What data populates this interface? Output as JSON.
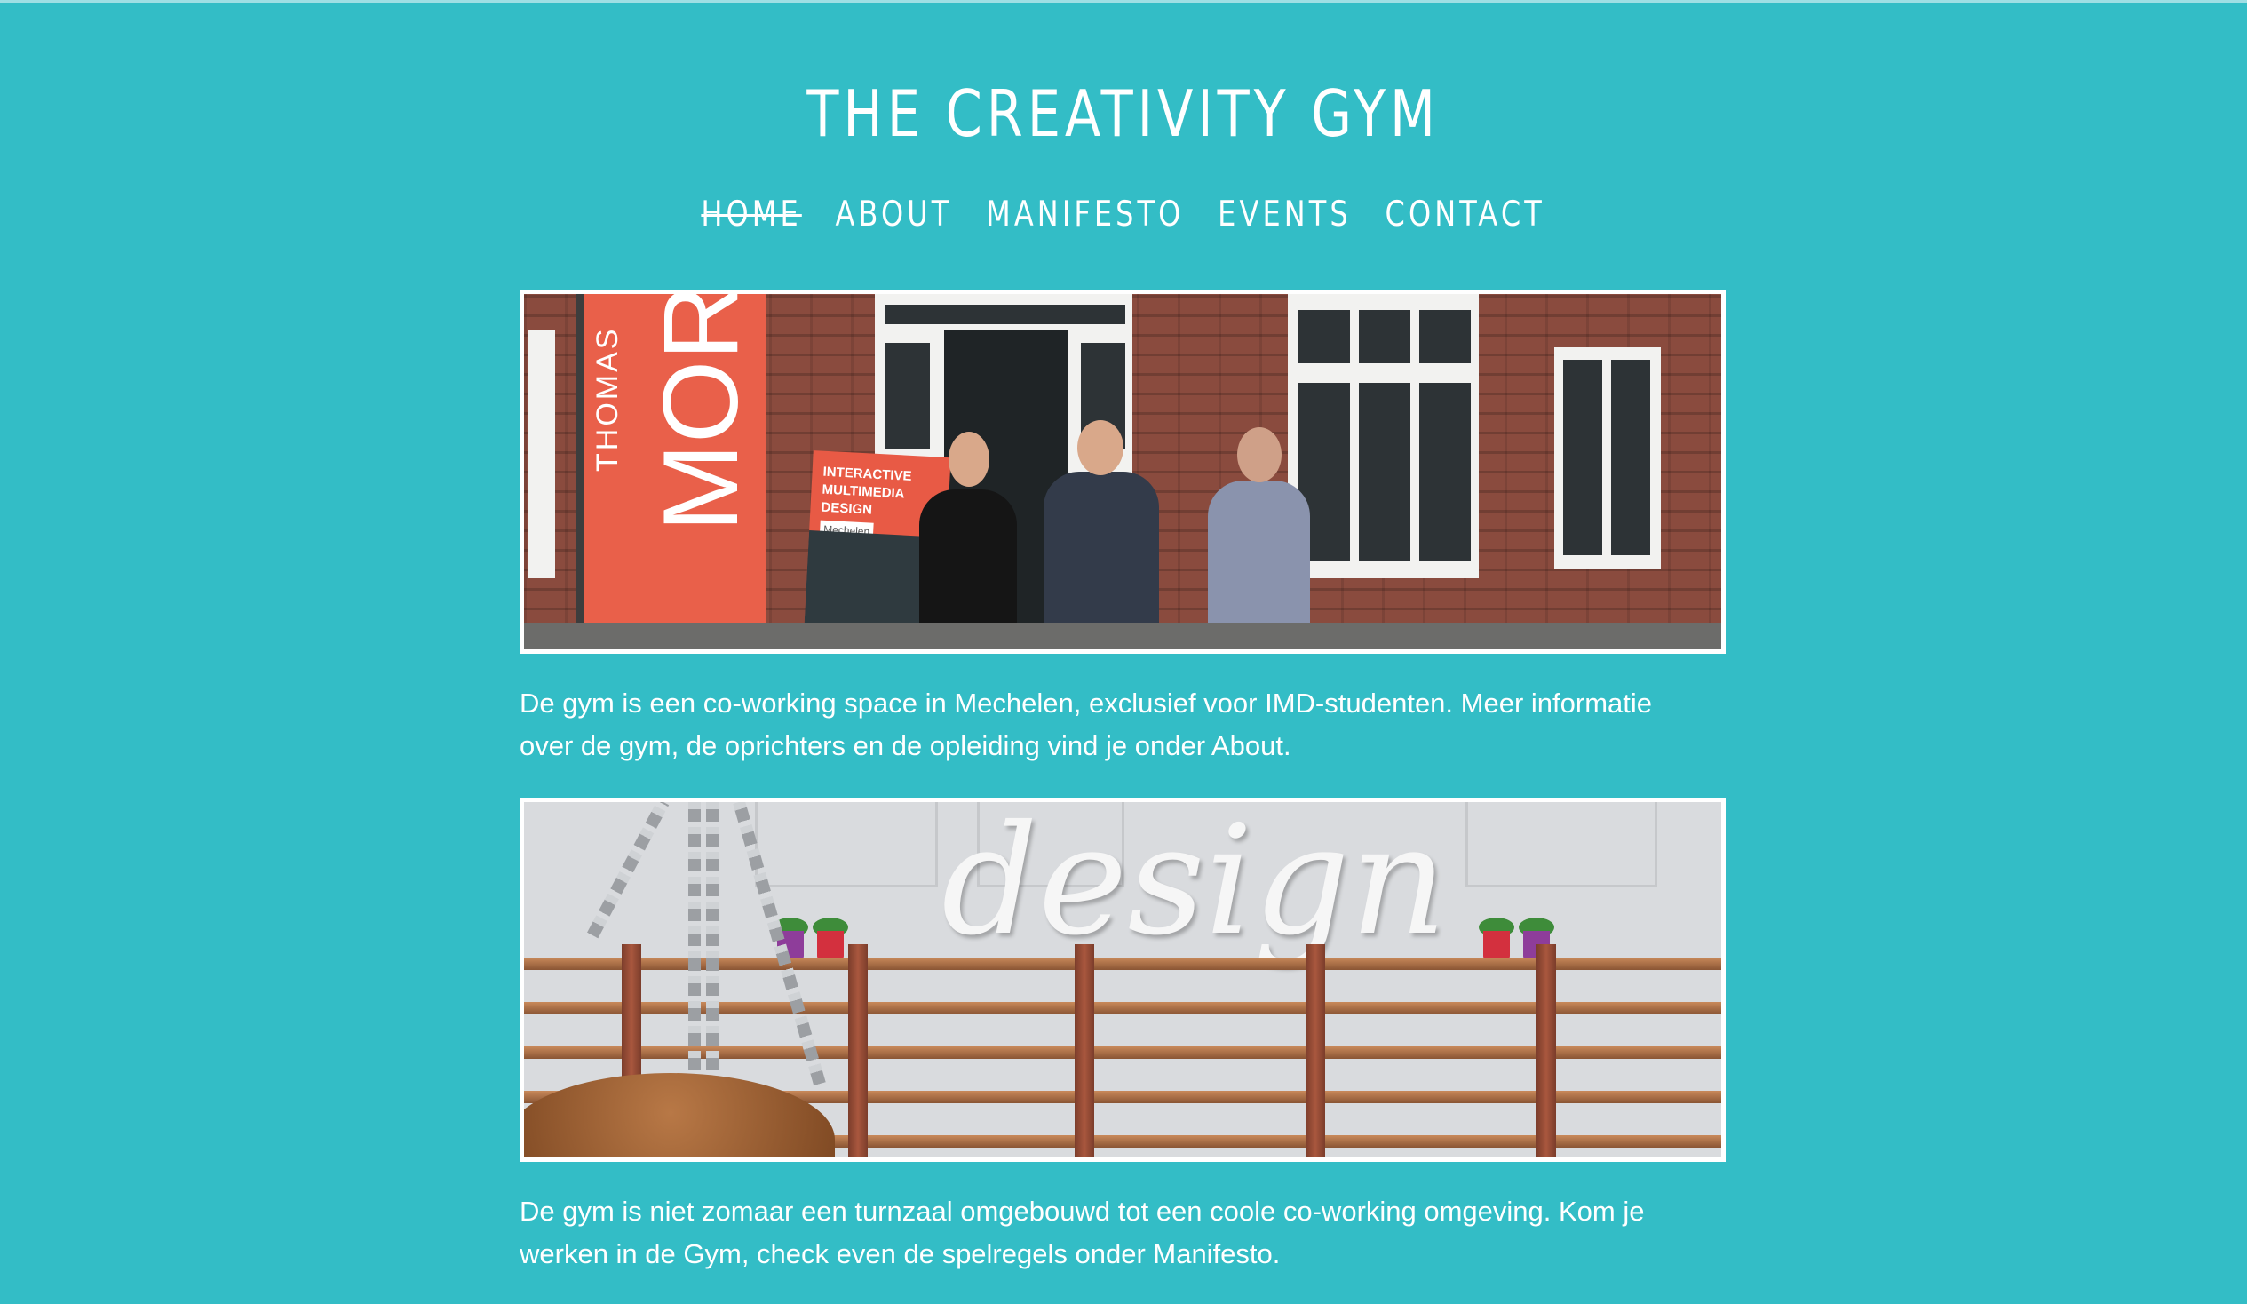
{
  "site": {
    "title": "THE CREATIVITY GYM"
  },
  "nav": {
    "items": [
      {
        "label": "HOME",
        "active": true
      },
      {
        "label": "ABOUT",
        "active": false
      },
      {
        "label": "MANIFESTO",
        "active": false
      },
      {
        "label": "EVENTS",
        "active": false
      },
      {
        "label": "CONTACT",
        "active": false
      }
    ]
  },
  "content": {
    "photo1": {
      "flag_small": "THOMAS",
      "flag_big": "MOR",
      "banner_line1": "INTERACTIVE",
      "banner_line2": "MULTIMEDIA DESIGN",
      "banner_tag": "Mechelen"
    },
    "paragraph1": "De gym is een co-working space in Mechelen, exclusief voor IMD-studenten. Meer informatie over de gym, de oprichters en de opleiding vind je onder About.",
    "photo2": {
      "wall_word": "design"
    },
    "paragraph2": "De gym is niet zomaar een turnzaal omgebouwd tot een coole co-working omgeving. Kom je werken in de Gym, check even de spelregels onder Manifesto."
  },
  "colors": {
    "background": "#33bdc6",
    "text": "#ffffff",
    "photo_border": "#ffffff"
  }
}
